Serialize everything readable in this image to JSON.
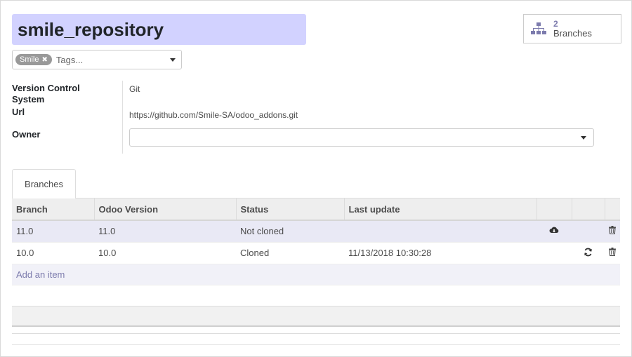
{
  "record": {
    "name": "smile_repository"
  },
  "stat_button": {
    "count": "2",
    "label": "Branches"
  },
  "tags": {
    "selected": [
      "Smile"
    ],
    "placeholder": "Tags..."
  },
  "fields": {
    "vcs_label_line1": "Version Control",
    "vcs_label_line2": "System",
    "vcs_value": "Git",
    "url_label": "Url",
    "url_value": "https://github.com/Smile-SA/odoo_addons.git",
    "owner_label": "Owner",
    "owner_value": ""
  },
  "tabs": [
    {
      "label": "Branches",
      "active": true
    }
  ],
  "branches_table": {
    "columns": [
      "Branch",
      "Odoo Version",
      "Status",
      "Last update",
      "",
      "",
      ""
    ],
    "rows": [
      {
        "branch": "11.0",
        "odoo_version": "11.0",
        "status": "Not cloned",
        "last_update": "",
        "action_icon": "cloud-download-icon",
        "delete_icon": "trash-icon"
      },
      {
        "branch": "10.0",
        "odoo_version": "10.0",
        "status": "Cloned",
        "last_update": "11/13/2018 10:30:28",
        "action_icon": "refresh-icon",
        "delete_icon": "trash-icon"
      }
    ],
    "add_item_label": "Add an item"
  },
  "colors": {
    "title_bg": "#d2d2ff",
    "accent": "#7c7bad",
    "tag_bg": "#999999",
    "selected_row_bg": "#e9e9f5"
  }
}
